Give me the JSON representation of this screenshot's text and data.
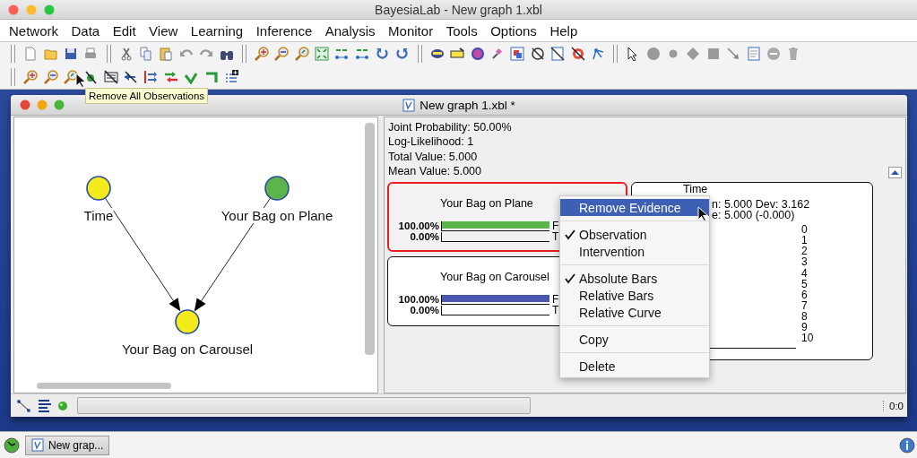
{
  "app_window": {
    "title": "BayesiaLab - New graph 1.xbl"
  },
  "menu_bar": [
    "Network",
    "Data",
    "Edit",
    "View",
    "Learning",
    "Inference",
    "Analysis",
    "Monitor",
    "Tools",
    "Options",
    "Help"
  ],
  "tooltip": "Remove All Observations",
  "graph_window": {
    "title": "New graph 1.xbl *",
    "nodes": [
      {
        "label": "Time",
        "color": "#f5ea1c"
      },
      {
        "label": "Your Bag on Plane",
        "color": "#5cb54a"
      },
      {
        "label": "Your Bag on Carousel",
        "color": "#f5ea1c"
      }
    ],
    "summary": [
      "Joint Probability: 50.00%",
      "Log-Likelihood: 1",
      "Total Value: 5.000",
      "Mean Value: 5.000"
    ],
    "monitors": [
      {
        "title": "Your Bag on Plane",
        "observed": true,
        "color": "#5cb54a",
        "states": [
          {
            "value": "100.00%",
            "label": "F",
            "level": 1
          },
          {
            "value": "0.00%",
            "label": "T",
            "level": 0
          }
        ]
      },
      {
        "title": "Your Bag on Carousel",
        "observed": false,
        "color": "#4a55b0",
        "states": [
          {
            "value": "100.00%",
            "label": "F",
            "level": 1
          },
          {
            "value": "0.00%",
            "label": "T",
            "level": 0
          }
        ]
      }
    ],
    "time_monitor": {
      "title": "Time",
      "stats": [
        "n: 5.000 Dev: 3.162",
        "e: 5.000 (-0.000)"
      ],
      "states": [
        "0",
        "1",
        "2",
        "3",
        "4",
        "5",
        "6",
        "7",
        "8",
        "9",
        "10"
      ]
    },
    "status": {
      "position": "0:0",
      "progress": {
        "level": 0
      }
    }
  },
  "context_menu": [
    [
      {
        "label": "Remove Evidence",
        "checked": false,
        "selected": true
      }
    ],
    [
      {
        "label": "Observation",
        "checked": true,
        "selected": false
      },
      {
        "label": "Intervention",
        "checked": false,
        "selected": false
      }
    ],
    [
      {
        "label": "Absolute Bars",
        "checked": true,
        "selected": false
      },
      {
        "label": "Relative Bars",
        "checked": false,
        "selected": false
      },
      {
        "label": "Relative Curve",
        "checked": false,
        "selected": false
      }
    ],
    [
      {
        "label": "Copy",
        "checked": false,
        "selected": false
      }
    ],
    [
      {
        "label": "Delete",
        "checked": false,
        "selected": false
      }
    ]
  ],
  "taskbar": {
    "items": [
      "New grap..."
    ]
  }
}
